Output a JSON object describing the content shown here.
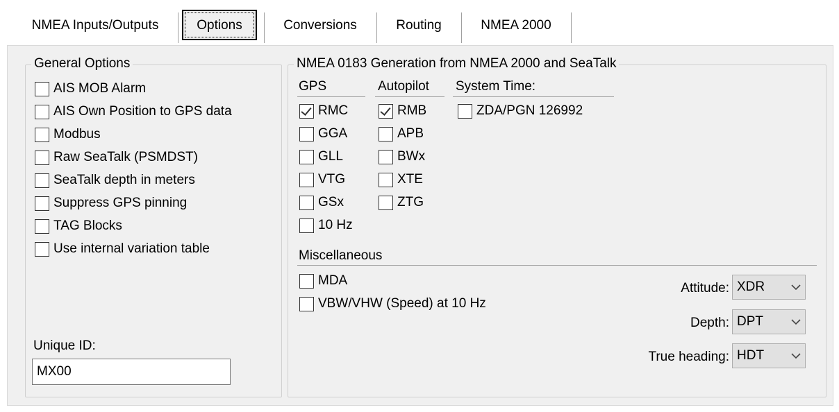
{
  "tabs": [
    {
      "label": "NMEA Inputs/Outputs"
    },
    {
      "label": "Options"
    },
    {
      "label": "Conversions"
    },
    {
      "label": "Routing"
    },
    {
      "label": "NMEA 2000"
    }
  ],
  "general_options": {
    "title": "General Options",
    "items": [
      {
        "label": "AIS MOB Alarm",
        "checked": false
      },
      {
        "label": "AIS Own Position to GPS data",
        "checked": false
      },
      {
        "label": "Modbus",
        "checked": false
      },
      {
        "label": "Raw SeaTalk (PSMDST)",
        "checked": false
      },
      {
        "label": "SeaTalk depth in meters",
        "checked": false
      },
      {
        "label": "Suppress GPS pinning",
        "checked": false
      },
      {
        "label": "TAG Blocks",
        "checked": false
      },
      {
        "label": "Use internal variation table",
        "checked": false
      }
    ],
    "unique_id_label": "Unique ID:",
    "unique_id_value": "MX00"
  },
  "generation": {
    "title": "NMEA 0183 Generation from NMEA 2000 and SeaTalk",
    "gps_header": "GPS",
    "autopilot_header": "Autopilot",
    "system_time_header": "System Time:",
    "gps": [
      {
        "label": "RMC",
        "checked": true
      },
      {
        "label": "GGA",
        "checked": false
      },
      {
        "label": "GLL",
        "checked": false
      },
      {
        "label": "VTG",
        "checked": false
      },
      {
        "label": "GSx",
        "checked": false
      },
      {
        "label": "10 Hz",
        "checked": false
      }
    ],
    "autopilot": [
      {
        "label": "RMB",
        "checked": true
      },
      {
        "label": "APB",
        "checked": false
      },
      {
        "label": "BWx",
        "checked": false
      },
      {
        "label": "XTE",
        "checked": false
      },
      {
        "label": "ZTG",
        "checked": false
      }
    ],
    "system_time": [
      {
        "label": "ZDA/PGN 126992",
        "checked": false
      }
    ],
    "misc_header": "Miscellaneous",
    "misc": [
      {
        "label": "MDA",
        "checked": false
      },
      {
        "label": "VBW/VHW (Speed) at 10 Hz",
        "checked": false
      }
    ],
    "attitude_label": "Attitude:",
    "attitude_value": "XDR",
    "depth_label": "Depth:",
    "depth_value": "DPT",
    "heading_label": "True heading:",
    "heading_value": "HDT"
  },
  "icons": {
    "dropdown": "chevron-down-icon",
    "check": "checkmark-icon"
  }
}
